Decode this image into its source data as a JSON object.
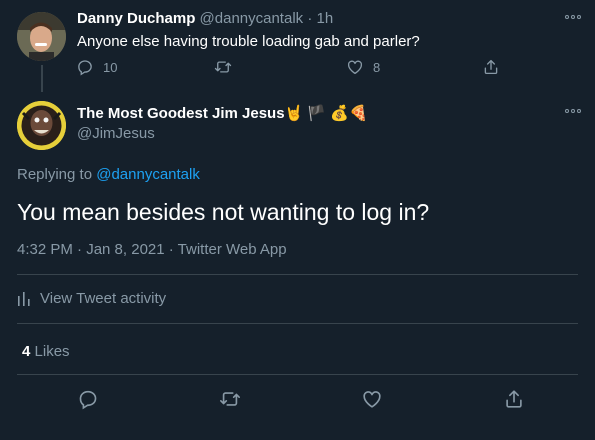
{
  "parent_tweet": {
    "display_name": "Danny Duchamp",
    "handle": "@dannycantalk",
    "separator": "·",
    "time_ago": "1h",
    "text": "Anyone else having trouble loading gab and parler?",
    "reply_count": "10",
    "like_count": "8"
  },
  "main_tweet": {
    "display_name": "The Most Goodest Jim Jesus",
    "name_emojis": [
      "🤘",
      "🏴",
      "💰",
      "🍕"
    ],
    "handle": "@JimJesus",
    "replying_prefix": "Replying to",
    "replying_to": "@dannycantalk",
    "text": "You mean besides not wanting to log in?",
    "timestamp": "4:32 PM · Jan 8, 2021 · Twitter Web App",
    "activity_label": "View Tweet activity",
    "likes_count": "4",
    "likes_label": "Likes"
  },
  "colors": {
    "background": "#15202b",
    "muted_text": "#8899a6",
    "link": "#1da1f2",
    "divider": "#38444d"
  }
}
